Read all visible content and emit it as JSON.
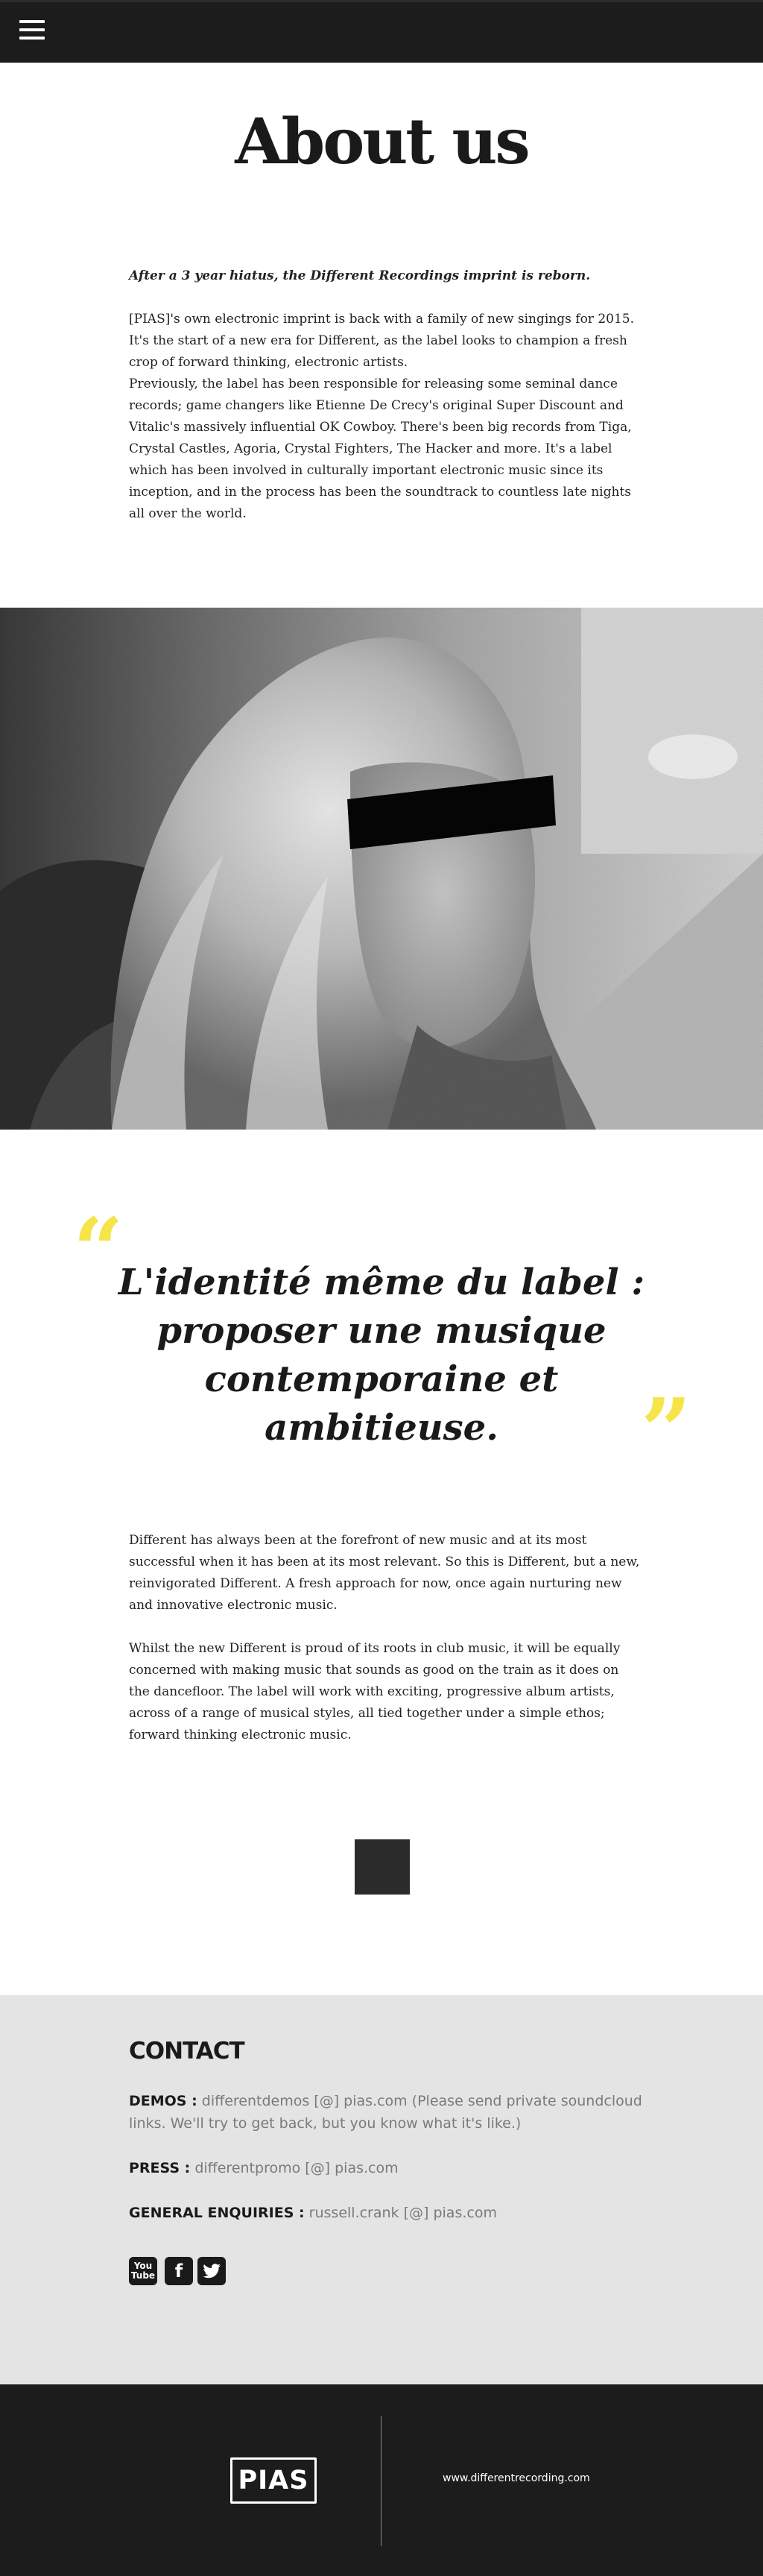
{
  "page": {
    "title": "About us"
  },
  "intro": {
    "lead": "After a 3 year hiatus, the Different Recordings imprint is reborn.",
    "paragraph_1": "[PIAS]'s own electronic imprint is back with a family of new singings for 2015. It's the start of a new era for Different, as the label looks to champion a fresh crop of forward thinking, electronic artists.",
    "paragraph_2": "Previously, the label has been responsible for releasing some seminal dance records; game changers like Etienne De Crecy's original Super Discount and Vitalic's massively influential OK Cowboy.  There's been big records from Tiga, Crystal Castles, Agoria, Crystal Fighters, The Hacker and more.  It's a label which has been involved in culturally important electronic music since its inception, and in the process has been the soundtrack to countless late nights all over the world."
  },
  "quote": {
    "open_mark": "“",
    "close_mark": "”",
    "text": "L'identité même du label : proposer une musique contemporaine et ambitieuse."
  },
  "body": {
    "paragraph_1": "Different has always been at the forefront of new music and at its most successful when it has been at its most relevant. So this is Different, but a new, reinvigorated Different. A fresh approach for now, once again nurturing new and innovative electronic music.",
    "paragraph_2": "Whilst the new Different is proud of its roots in club music, it will be equally concerned with making music that sounds as good on the train as it does on the dancefloor. The label will work with exciting, progressive album artists, across of a range of musical styles, all tied together under a simple ethos; forward thinking electronic music."
  },
  "contact": {
    "heading": "CONTACT",
    "demos_label": "DEMOS :",
    "demos_value": "differentdemos [@] pias.com (Please send private soundcloud links. We'll try to get back, but you know what it's like.)",
    "press_label": "PRESS :",
    "press_value": "differentpromo [@] pias.com",
    "general_label": "GENERAL ENQUIRIES :",
    "general_value": "russell.crank [@] pias.com",
    "socials": {
      "youtube_top": "You",
      "youtube_bottom": "Tube",
      "facebook": "f",
      "twitter_icon": "twitter-bird"
    }
  },
  "footer": {
    "logo_text": "PIAS",
    "link": "www.differentrecording.com"
  },
  "colors": {
    "dark": "#1c1c1c",
    "accent_yellow": "#f6e54a",
    "contact_bg": "#e4e4e4",
    "muted_text": "#7a7a7a"
  }
}
